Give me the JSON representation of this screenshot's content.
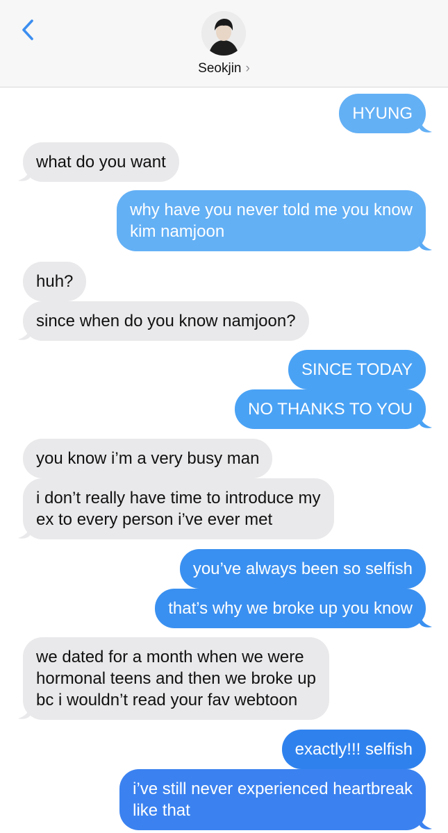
{
  "header": {
    "contact_name": "Seokjin",
    "chevron": "›"
  },
  "messages": [
    {
      "side": "out",
      "text": "HYUNG"
    },
    {
      "side": "in",
      "text": "what do you want"
    },
    {
      "side": "out",
      "text": "why have you never told me you know\nkim namjoon"
    },
    {
      "side": "in",
      "text": "huh?"
    },
    {
      "side": "in",
      "text": "since when do you know namjoon?"
    },
    {
      "side": "out",
      "text": "SINCE TODAY"
    },
    {
      "side": "out",
      "text": "NO THANKS TO YOU"
    },
    {
      "side": "in",
      "text": "you know i’m a very busy man"
    },
    {
      "side": "in",
      "text": "i don’t really have time to introduce my\nex to every person i’ve ever met"
    },
    {
      "side": "out",
      "text": "you’ve always been so selfish"
    },
    {
      "side": "out",
      "text": "that’s why we broke up you know"
    },
    {
      "side": "in",
      "text": "we dated for a month when we were\nhormonal teens and then we broke up\nbc i wouldn’t read your fav webtoon"
    },
    {
      "side": "out",
      "text": "exactly!!! selfish"
    },
    {
      "side": "out",
      "text": "i’ve still never experienced heartbreak\nlike that"
    }
  ],
  "icons": {
    "back": "back-chevron-icon",
    "avatar": "contact-avatar"
  },
  "colors": {
    "sent_bubble": "#3e95f2",
    "received_bubble": "#e9e9eb",
    "back_arrow": "#3c8ef0"
  }
}
